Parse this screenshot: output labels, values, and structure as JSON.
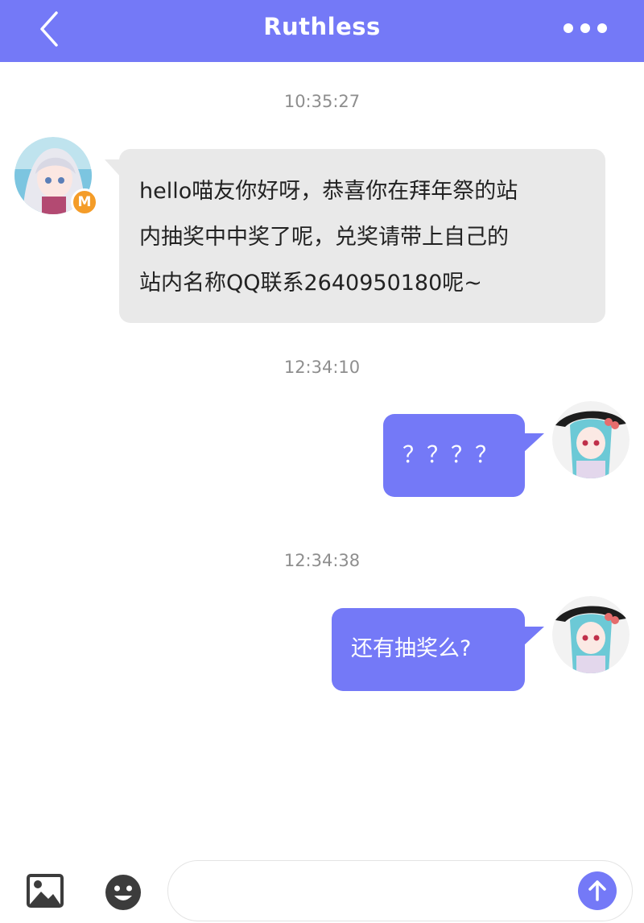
{
  "header": {
    "title": "Ruthless",
    "back_icon": "chevron-left-icon",
    "more_icon": "more-dots-icon",
    "background_color": "#7479f7"
  },
  "messages": [
    {
      "timestamp": "10:35:27",
      "direction": "incoming",
      "lines": [
        "hello喵友你好呀，恭喜你在拜年祭的站",
        "内抽奖中中奖了呢，兑奖请带上自己的",
        "站内名称QQ联系2640950180呢~"
      ],
      "avatar_badge": "M"
    },
    {
      "timestamp": "12:34:10",
      "direction": "outgoing",
      "text": "？？？？"
    },
    {
      "timestamp": "12:34:38",
      "direction": "outgoing",
      "text": "还有抽奖么?"
    }
  ],
  "composer": {
    "image_icon": "image-icon",
    "emoji_icon": "emoji-icon",
    "send_icon": "arrow-up-icon",
    "input_value": "",
    "input_placeholder": ""
  },
  "colors": {
    "accent": "#7479f7",
    "incoming_bubble": "#e9e9e9",
    "badge": "#f49c28",
    "timestamp": "#8e8e8e"
  }
}
